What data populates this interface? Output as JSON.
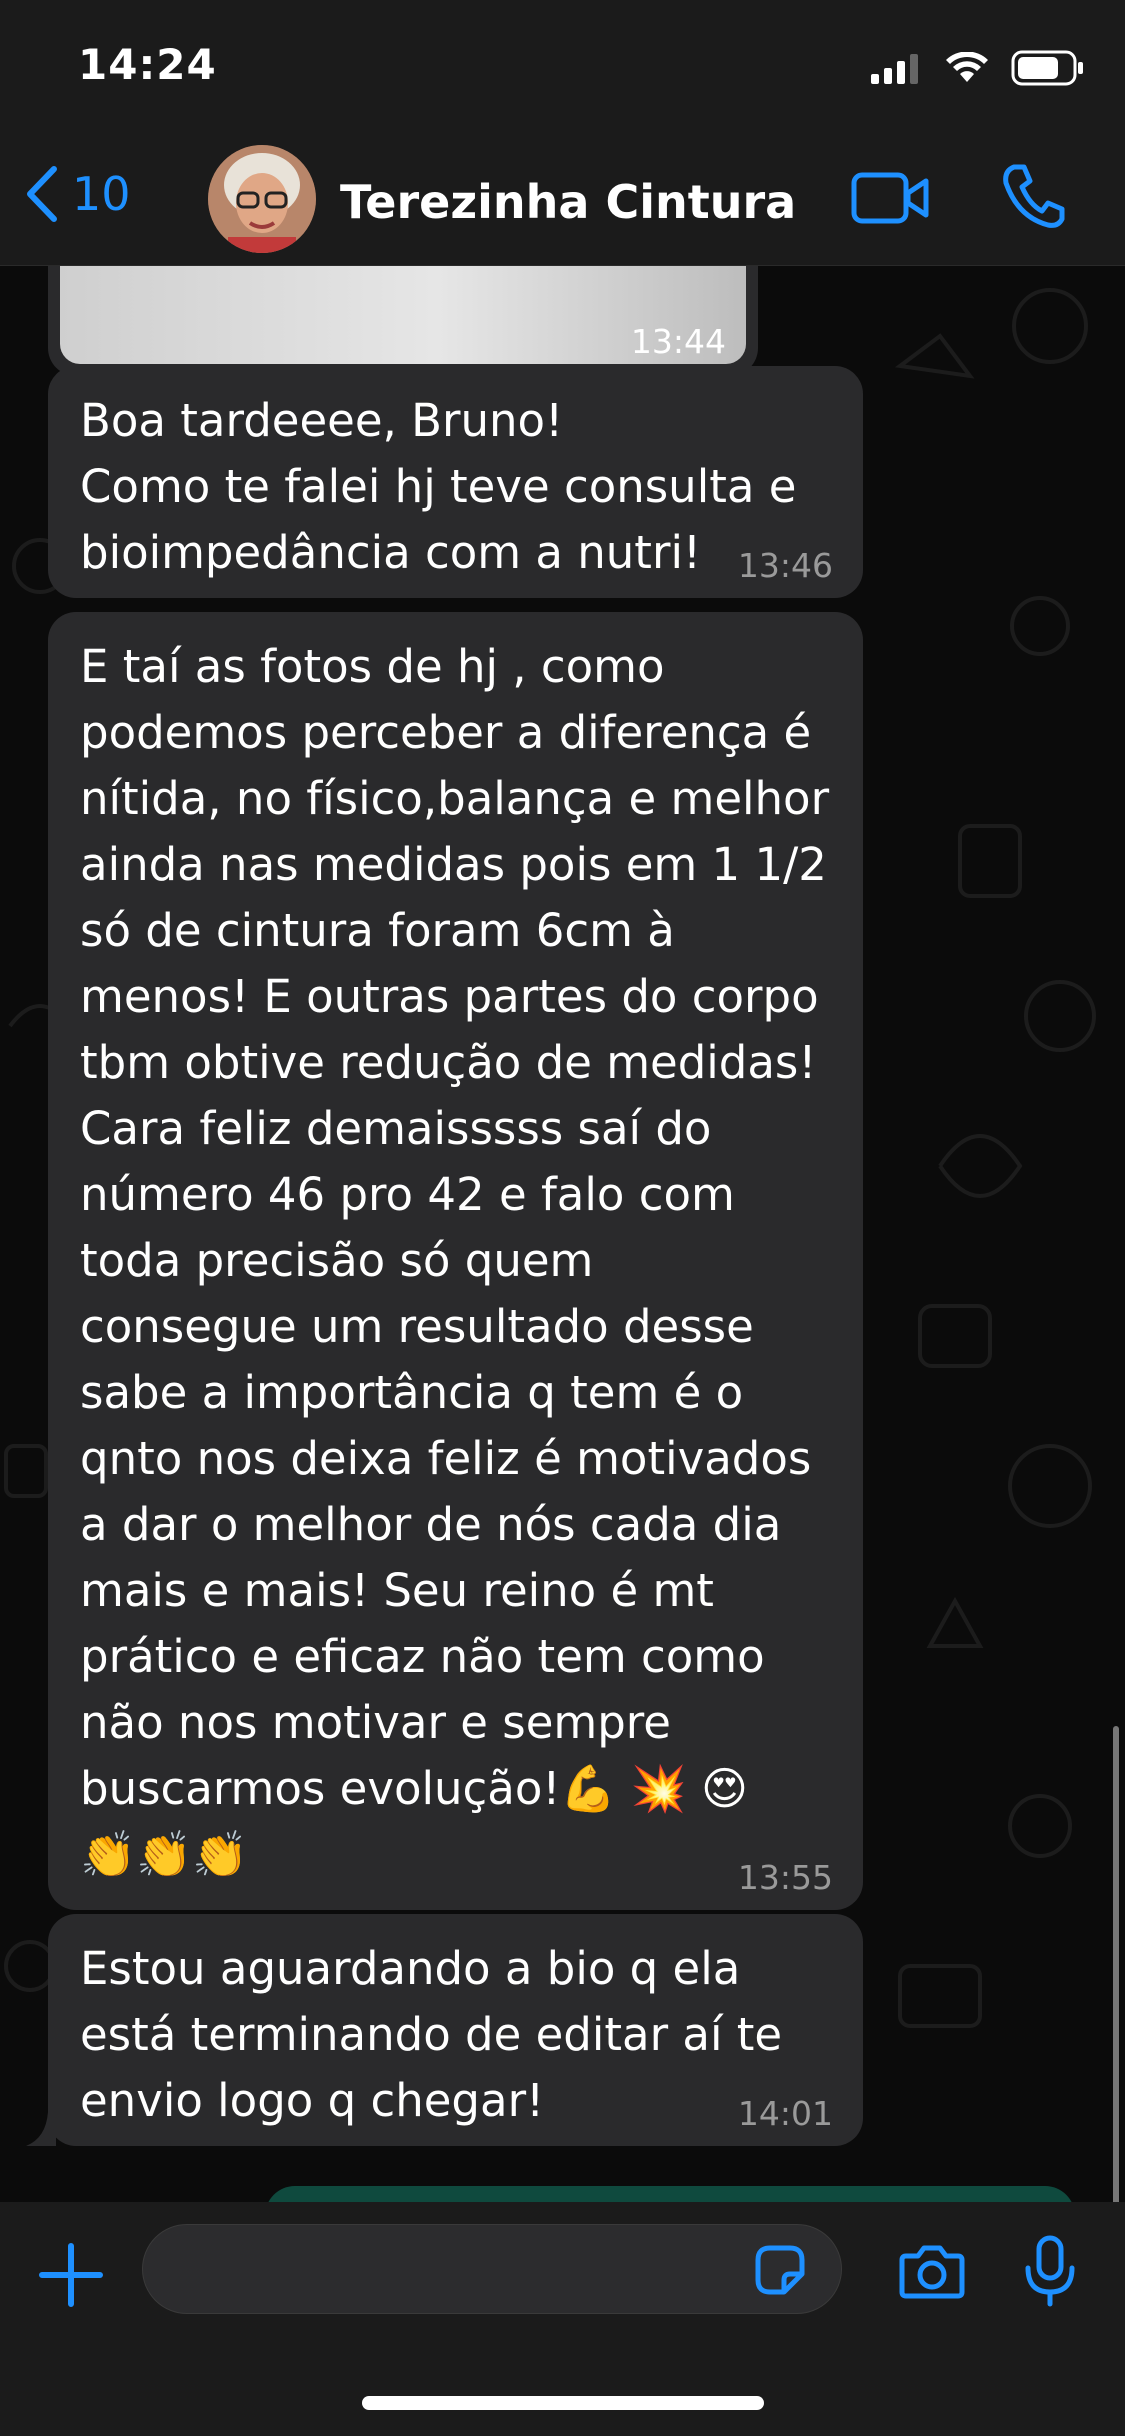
{
  "status_bar": {
    "time": "14:24",
    "icons": [
      "signal-icon",
      "wifi-icon",
      "battery-icon"
    ]
  },
  "header": {
    "back_count": "10",
    "contact_name": "Terezinha Cintura",
    "icons": [
      "chevron-left-icon",
      "video-call-icon",
      "phone-call-icon"
    ]
  },
  "messages": [
    {
      "type": "image",
      "time": "13:44"
    },
    {
      "type": "text",
      "lines": [
        "Boa tardeeee, Bruno!",
        "Como te falei hj teve consulta e",
        "bioimpedância com a nutri!"
      ],
      "time": "13:46"
    },
    {
      "type": "text",
      "lines": [
        "E taí as fotos de hj , como",
        "podemos perceber a diferença é",
        "nítida, no físico,balança e melhor",
        "ainda nas medidas pois em 1 1/2",
        "só de cintura foram 6cm à",
        "menos! E outras partes do corpo",
        "tbm obtive redução de medidas!",
        "Cara feliz demaisssss saí do",
        "número 46 pro 42 e falo com",
        "toda precisão só quem",
        "consegue um resultado desse",
        "sabe a importância q tem é o",
        "qnto nos deixa feliz é motivados",
        "a dar o melhor de nós cada dia",
        "mais e mais! Seu reino é mt",
        "prático e eficaz não tem como",
        "não nos motivar e sempre",
        "buscarmos evolução!💪 💥 😍",
        "👏👏👏"
      ],
      "time": "13:55"
    },
    {
      "type": "text",
      "lines": [
        "Estou aguardando a bio q ela",
        "está terminando de editar aí te",
        "envio logo q chegar!"
      ],
      "time": "14:01"
    }
  ],
  "input": {
    "placeholder": "",
    "icons": [
      "plus-icon",
      "sticker-icon",
      "camera-icon",
      "microphone-icon"
    ]
  },
  "colors": {
    "accent": "#1e90ff",
    "bubble": "#2a2a2c",
    "background": "#0b0b0b",
    "bar": "#1b1b1b"
  }
}
